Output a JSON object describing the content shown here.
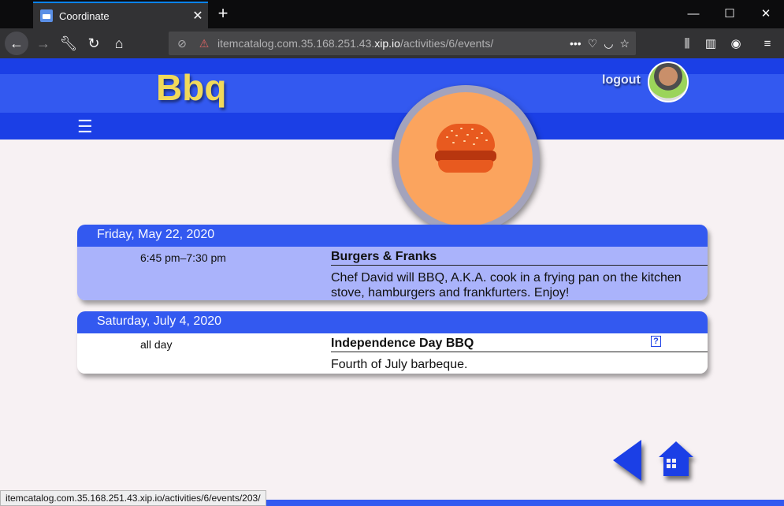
{
  "browser": {
    "tab_title": "Coordinate",
    "url_prefix": "itemcatalog.com.35.168.251.43.",
    "url_domain": "xip.io",
    "url_path": "/activities/6/events/",
    "status_url": "itemcatalog.com.35.168.251.43.xip.io/activities/6/events/203/"
  },
  "header": {
    "site_title": "Bbq",
    "logout_label": "logout"
  },
  "days": [
    {
      "date": "Friday, May 22, 2020",
      "events": [
        {
          "time": "6:45 pm–7:30 pm",
          "title": "Burgers & Franks",
          "description": "Chef David will BBQ, A.K.A. cook in a frying pan on the kitchen stove, hamburgers and frankfurters. Enjoy!"
        }
      ]
    },
    {
      "date": "Saturday, July 4, 2020",
      "events": [
        {
          "time": "all day",
          "title": "Independence Day BBQ",
          "description": "Fourth of July barbeque.",
          "help": "?"
        }
      ]
    }
  ],
  "colors": {
    "header_blue": "#3359f0",
    "header_dark_blue": "#1b3fe6",
    "title_yellow": "#f1d95a",
    "event_highlight": "#aab3fb",
    "logo_orange": "#fba45e"
  }
}
